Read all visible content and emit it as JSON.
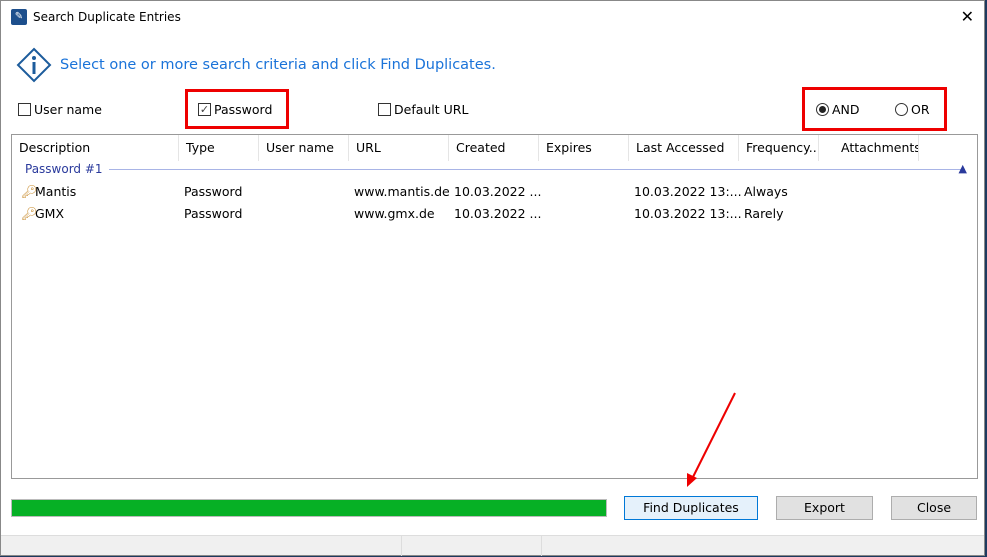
{
  "window": {
    "title": "Search Duplicate Entries"
  },
  "info": {
    "message": "Select one or more search criteria and click Find Duplicates."
  },
  "criteria": {
    "user_name": {
      "label": "User name",
      "checked": false
    },
    "password": {
      "label": "Password",
      "checked": true
    },
    "default_url": {
      "label": "Default URL",
      "checked": false
    },
    "and": {
      "label": "AND",
      "selected": true
    },
    "or": {
      "label": "OR",
      "selected": false
    }
  },
  "table": {
    "columns": [
      "Description",
      "Type",
      "User name",
      "URL",
      "Created",
      "Expires",
      "Last Accessed",
      "Frequency...",
      "Attachments"
    ],
    "group": "Password #1",
    "rows": [
      [
        "Mantis",
        "Password",
        "",
        "www.mantis.de",
        "10.03.2022 ...",
        "",
        "10.03.2022 13:...",
        "Always",
        ""
      ],
      [
        "GMX",
        "Password",
        "",
        "www.gmx.de",
        "10.03.2022 ...",
        "",
        "10.03.2022 13:...",
        "Rarely",
        ""
      ]
    ]
  },
  "progress": {
    "percent": 100,
    "color": "#06b025"
  },
  "buttons": {
    "find": "Find Duplicates",
    "export": "Export",
    "close": "Close"
  },
  "colors": {
    "accent": "#1a73d9",
    "highlight": "#e00000"
  }
}
